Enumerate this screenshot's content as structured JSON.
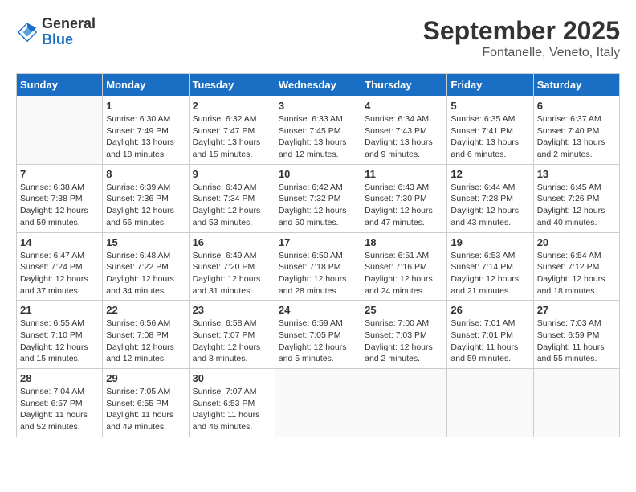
{
  "header": {
    "logo": {
      "general": "General",
      "blue": "Blue"
    },
    "title": "September 2025",
    "subtitle": "Fontanelle, Veneto, Italy"
  },
  "days_of_week": [
    "Sunday",
    "Monday",
    "Tuesday",
    "Wednesday",
    "Thursday",
    "Friday",
    "Saturday"
  ],
  "weeks": [
    [
      {
        "day": "",
        "info": ""
      },
      {
        "day": "1",
        "info": "Sunrise: 6:30 AM\nSunset: 7:49 PM\nDaylight: 13 hours\nand 18 minutes."
      },
      {
        "day": "2",
        "info": "Sunrise: 6:32 AM\nSunset: 7:47 PM\nDaylight: 13 hours\nand 15 minutes."
      },
      {
        "day": "3",
        "info": "Sunrise: 6:33 AM\nSunset: 7:45 PM\nDaylight: 13 hours\nand 12 minutes."
      },
      {
        "day": "4",
        "info": "Sunrise: 6:34 AM\nSunset: 7:43 PM\nDaylight: 13 hours\nand 9 minutes."
      },
      {
        "day": "5",
        "info": "Sunrise: 6:35 AM\nSunset: 7:41 PM\nDaylight: 13 hours\nand 6 minutes."
      },
      {
        "day": "6",
        "info": "Sunrise: 6:37 AM\nSunset: 7:40 PM\nDaylight: 13 hours\nand 2 minutes."
      }
    ],
    [
      {
        "day": "7",
        "info": "Sunrise: 6:38 AM\nSunset: 7:38 PM\nDaylight: 12 hours\nand 59 minutes."
      },
      {
        "day": "8",
        "info": "Sunrise: 6:39 AM\nSunset: 7:36 PM\nDaylight: 12 hours\nand 56 minutes."
      },
      {
        "day": "9",
        "info": "Sunrise: 6:40 AM\nSunset: 7:34 PM\nDaylight: 12 hours\nand 53 minutes."
      },
      {
        "day": "10",
        "info": "Sunrise: 6:42 AM\nSunset: 7:32 PM\nDaylight: 12 hours\nand 50 minutes."
      },
      {
        "day": "11",
        "info": "Sunrise: 6:43 AM\nSunset: 7:30 PM\nDaylight: 12 hours\nand 47 minutes."
      },
      {
        "day": "12",
        "info": "Sunrise: 6:44 AM\nSunset: 7:28 PM\nDaylight: 12 hours\nand 43 minutes."
      },
      {
        "day": "13",
        "info": "Sunrise: 6:45 AM\nSunset: 7:26 PM\nDaylight: 12 hours\nand 40 minutes."
      }
    ],
    [
      {
        "day": "14",
        "info": "Sunrise: 6:47 AM\nSunset: 7:24 PM\nDaylight: 12 hours\nand 37 minutes."
      },
      {
        "day": "15",
        "info": "Sunrise: 6:48 AM\nSunset: 7:22 PM\nDaylight: 12 hours\nand 34 minutes."
      },
      {
        "day": "16",
        "info": "Sunrise: 6:49 AM\nSunset: 7:20 PM\nDaylight: 12 hours\nand 31 minutes."
      },
      {
        "day": "17",
        "info": "Sunrise: 6:50 AM\nSunset: 7:18 PM\nDaylight: 12 hours\nand 28 minutes."
      },
      {
        "day": "18",
        "info": "Sunrise: 6:51 AM\nSunset: 7:16 PM\nDaylight: 12 hours\nand 24 minutes."
      },
      {
        "day": "19",
        "info": "Sunrise: 6:53 AM\nSunset: 7:14 PM\nDaylight: 12 hours\nand 21 minutes."
      },
      {
        "day": "20",
        "info": "Sunrise: 6:54 AM\nSunset: 7:12 PM\nDaylight: 12 hours\nand 18 minutes."
      }
    ],
    [
      {
        "day": "21",
        "info": "Sunrise: 6:55 AM\nSunset: 7:10 PM\nDaylight: 12 hours\nand 15 minutes."
      },
      {
        "day": "22",
        "info": "Sunrise: 6:56 AM\nSunset: 7:08 PM\nDaylight: 12 hours\nand 12 minutes."
      },
      {
        "day": "23",
        "info": "Sunrise: 6:58 AM\nSunset: 7:07 PM\nDaylight: 12 hours\nand 8 minutes."
      },
      {
        "day": "24",
        "info": "Sunrise: 6:59 AM\nSunset: 7:05 PM\nDaylight: 12 hours\nand 5 minutes."
      },
      {
        "day": "25",
        "info": "Sunrise: 7:00 AM\nSunset: 7:03 PM\nDaylight: 12 hours\nand 2 minutes."
      },
      {
        "day": "26",
        "info": "Sunrise: 7:01 AM\nSunset: 7:01 PM\nDaylight: 11 hours\nand 59 minutes."
      },
      {
        "day": "27",
        "info": "Sunrise: 7:03 AM\nSunset: 6:59 PM\nDaylight: 11 hours\nand 55 minutes."
      }
    ],
    [
      {
        "day": "28",
        "info": "Sunrise: 7:04 AM\nSunset: 6:57 PM\nDaylight: 11 hours\nand 52 minutes."
      },
      {
        "day": "29",
        "info": "Sunrise: 7:05 AM\nSunset: 6:55 PM\nDaylight: 11 hours\nand 49 minutes."
      },
      {
        "day": "30",
        "info": "Sunrise: 7:07 AM\nSunset: 6:53 PM\nDaylight: 11 hours\nand 46 minutes."
      },
      {
        "day": "",
        "info": ""
      },
      {
        "day": "",
        "info": ""
      },
      {
        "day": "",
        "info": ""
      },
      {
        "day": "",
        "info": ""
      }
    ]
  ]
}
